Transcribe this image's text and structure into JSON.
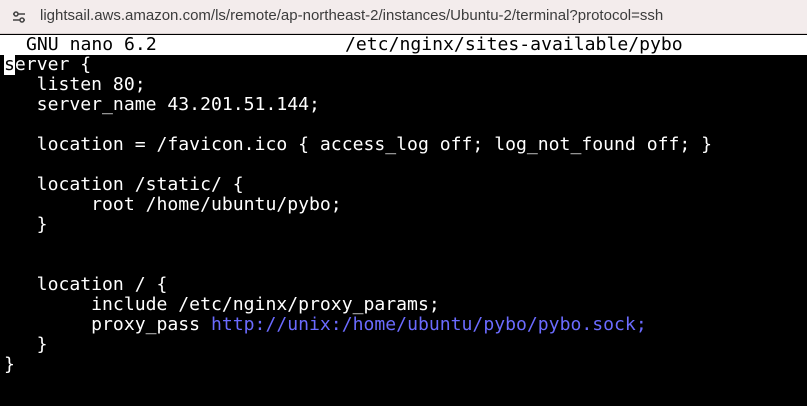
{
  "browser": {
    "url": "lightsail.aws.amazon.com/ls/remote/ap-northeast-2/instances/Ubuntu-2/terminal?protocol=ssh",
    "site_icon": "tune-icon"
  },
  "nano": {
    "version": "GNU nano 6.2",
    "filename": "/etc/nginx/sites-available/pybo",
    "lines": [
      {
        "pre": "",
        "cursor": "s",
        "text": "erver {",
        "link": ""
      },
      {
        "pre": "",
        "cursor": "",
        "text": "   listen 80;",
        "link": ""
      },
      {
        "pre": "",
        "cursor": "",
        "text": "   server_name 43.201.51.144;",
        "link": ""
      },
      {
        "pre": "",
        "cursor": "",
        "text": "",
        "link": ""
      },
      {
        "pre": "",
        "cursor": "",
        "text": "   location = /favicon.ico { access_log off; log_not_found off; }",
        "link": ""
      },
      {
        "pre": "",
        "cursor": "",
        "text": "",
        "link": ""
      },
      {
        "pre": "",
        "cursor": "",
        "text": "   location /static/ {",
        "link": ""
      },
      {
        "pre": "",
        "cursor": "",
        "text": "        root /home/ubuntu/pybo;",
        "link": ""
      },
      {
        "pre": "",
        "cursor": "",
        "text": "   }",
        "link": ""
      },
      {
        "pre": "",
        "cursor": "",
        "text": "",
        "link": ""
      },
      {
        "pre": "",
        "cursor": "",
        "text": "",
        "link": ""
      },
      {
        "pre": "",
        "cursor": "",
        "text": "   location / {",
        "link": ""
      },
      {
        "pre": "",
        "cursor": "",
        "text": "        include /etc/nginx/proxy_params;",
        "link": ""
      },
      {
        "pre": "",
        "cursor": "",
        "text": "        proxy_pass ",
        "link": "http://unix:/home/ubuntu/pybo/pybo.sock;"
      },
      {
        "pre": "",
        "cursor": "",
        "text": "   }",
        "link": ""
      },
      {
        "pre": "",
        "cursor": "",
        "text": "}",
        "link": ""
      }
    ]
  }
}
